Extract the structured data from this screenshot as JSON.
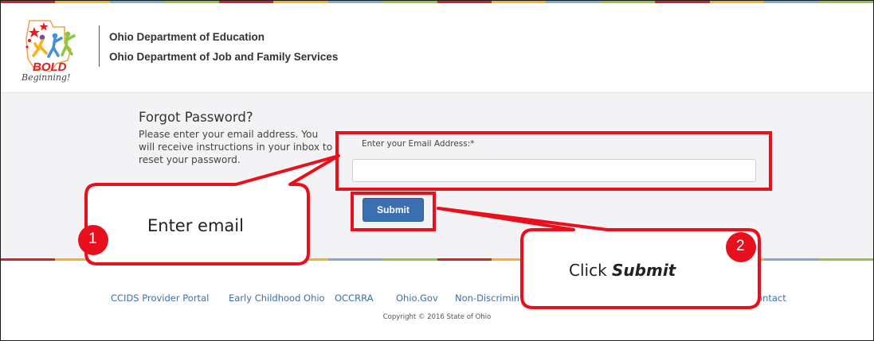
{
  "header": {
    "logo": {
      "icon": "bold-beginning-logo",
      "line1": "BOLD",
      "line2": "Beginning!"
    },
    "agency_1": "Ohio Department of Education",
    "agency_2": "Ohio Department of Job and Family Services"
  },
  "form": {
    "title": "Forgot Password?",
    "description": "Please enter your email address. You will receive instructions in your inbox to reset your password.",
    "email_label": "Enter your Email Address:*",
    "email_value": "",
    "submit_label": "Submit"
  },
  "footer": {
    "links": [
      "CCIDS Provider Portal",
      "Early Childhood Ohio",
      "OCCRRA",
      "Ohio.Gov",
      "Non-Discrimin",
      "Contact"
    ],
    "copyright": "Copyright © 2016 State of Ohio"
  },
  "annotations": {
    "step1": {
      "number": "1",
      "text": "Enter email"
    },
    "step2": {
      "number": "2",
      "prefix": "Click ",
      "emphasis": "Submit"
    }
  },
  "colors": {
    "highlight_red": "#e8101c",
    "button_blue": "#3b6fb1",
    "link_blue": "#3d6fa7",
    "stripe": [
      "#e31b23",
      "#f6b31c",
      "#7ea8d6",
      "#8dc63f"
    ]
  }
}
